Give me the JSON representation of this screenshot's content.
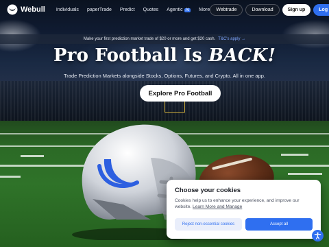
{
  "nav": {
    "brand": "Webull",
    "links": [
      "Individuals",
      "paperTrade",
      "Predict",
      "Quotes",
      "Agentic",
      "More"
    ],
    "agentic_badge": "AI",
    "webtrade": "Webtrade",
    "download": "Download",
    "signup": "Sign up",
    "login": "Log in"
  },
  "promo": {
    "text": "Make your first prediction market trade of $20 or more and get $20 cash.",
    "link": "T&C's apply →"
  },
  "hero": {
    "title_main": "Pro Football Is ",
    "title_emph": "BACK!",
    "subtitle": "Trade Prediction Markets alongside Stocks, Options, Futures, and Crypto. All in one app.",
    "cta": "Explore Pro Football"
  },
  "cookie": {
    "title": "Choose your cookies",
    "text": "Cookies help us to enhance your experience, and improve our website.",
    "link": "Learn More and Manage",
    "reject": "Reject non-essential cookies",
    "accept": "Accept all"
  },
  "colors": {
    "accent": "#2f6ff0",
    "helmet_logo": "#2d5fe0"
  },
  "icons": {
    "brand_logo": "webull-logo-icon",
    "accessibility": "accessibility-icon"
  }
}
